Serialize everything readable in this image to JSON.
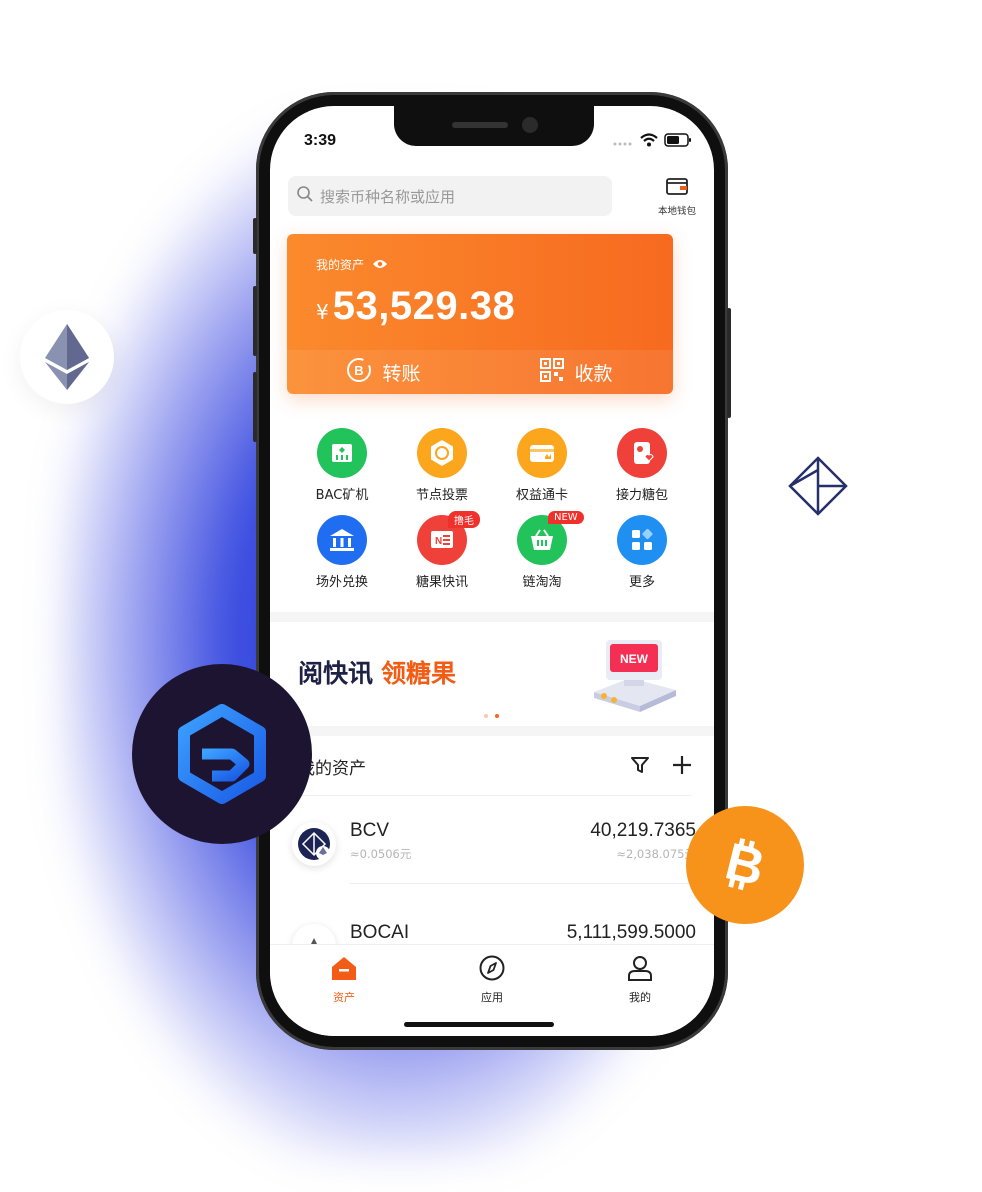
{
  "status": {
    "time": "3:39"
  },
  "search": {
    "placeholder": "搜索币种名称或应用"
  },
  "wallet": {
    "label": "本地钱包"
  },
  "asset_card": {
    "label": "我的资产",
    "currency": "¥",
    "amount": "53,529.38",
    "transfer_label": "转账",
    "receive_label": "收款"
  },
  "apps": [
    {
      "label": "BAC矿机",
      "color": "#22c35b",
      "icon": "mining-machine-icon"
    },
    {
      "label": "节点投票",
      "color": "#fba61c",
      "icon": "node-vote-icon"
    },
    {
      "label": "权益通卡",
      "color": "#fba61c",
      "icon": "rights-card-icon"
    },
    {
      "label": "接力糖包",
      "color": "#f0403a",
      "icon": "candy-relay-icon"
    },
    {
      "label": "场外兑换",
      "color": "#1f6ef2",
      "icon": "otc-exchange-icon"
    },
    {
      "label": "糖果快讯",
      "color": "#f0403a",
      "icon": "candy-news-icon",
      "tag": "撸毛"
    },
    {
      "label": "链淘淘",
      "color": "#22c35b",
      "icon": "chain-shop-icon",
      "tag": "NEW"
    },
    {
      "label": "更多",
      "color": "#1f8ff2",
      "icon": "more-apps-icon"
    }
  ],
  "banner": {
    "text_a": "阅快讯",
    "text_b": "领糖果",
    "badge": "NEW"
  },
  "assets_section": {
    "title": "我的资产"
  },
  "coins": [
    {
      "name": "BCV",
      "sub": "≈0.0506元",
      "balance": "40,219.7365",
      "value": "≈2,038.075元"
    },
    {
      "name": "BOCAI",
      "sub": "",
      "balance": "5,111,599.5000",
      "value": ""
    }
  ],
  "tabs": [
    {
      "label": "资产",
      "active": true
    },
    {
      "label": "应用",
      "active": false
    },
    {
      "label": "我的",
      "active": false
    }
  ],
  "colors": {
    "accent": "#f76a20",
    "brand_dark": "#1d1431",
    "bitcoin": "#f7931a"
  }
}
